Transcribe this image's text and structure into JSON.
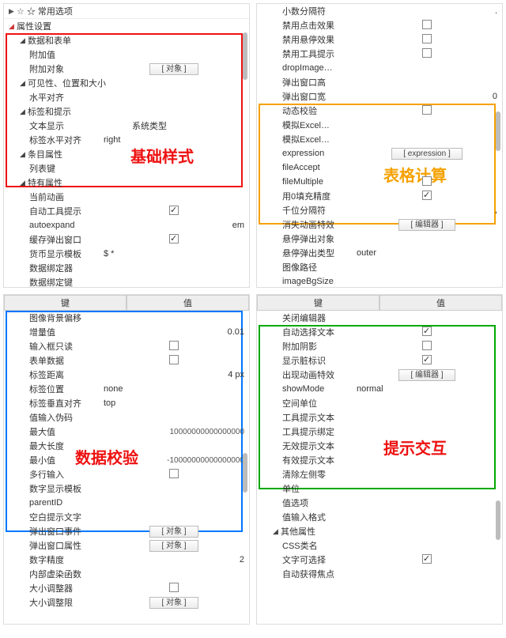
{
  "topLeft": {
    "headers": [
      "☆ 常用选项",
      "属性设置"
    ],
    "groups": [
      {
        "label": "数据和表单",
        "items": [
          {
            "label": "附加值"
          },
          {
            "label": "附加对象",
            "button": "[ 对象 ]"
          }
        ]
      },
      {
        "label": "可见性、位置和大小",
        "items": [
          {
            "label": "水平对齐"
          }
        ]
      },
      {
        "label": "标签和提示",
        "items": [
          {
            "label": "文本显示",
            "value": "系统类型"
          },
          {
            "label": "标签水平对齐",
            "value": "right"
          }
        ]
      },
      {
        "label": "条目属性",
        "items": [
          {
            "label": "列表键"
          }
        ]
      },
      {
        "label": "特有属性",
        "items": [
          {
            "label": "当前动画"
          },
          {
            "label": "自动工具提示",
            "checkbox": true
          },
          {
            "label": "autoexpand",
            "value": "em"
          },
          {
            "label": "缓存弹出窗口",
            "checkbox": true
          },
          {
            "label": "货币显示模板",
            "value_left": "$ *"
          },
          {
            "label": "数据绑定器"
          },
          {
            "label": "数据绑定键"
          }
        ]
      }
    ],
    "annotation": "基础样式"
  },
  "topRight": {
    "items_pre": [
      {
        "label": "小数分隔符",
        "value": "."
      },
      {
        "label": "禁用点击效果",
        "checkbox": false
      },
      {
        "label": "禁用悬停效果",
        "checkbox": false
      },
      {
        "label": "禁用工具提示",
        "checkbox": false
      },
      {
        "label": "dropImage…"
      },
      {
        "label": "弹出窗口高"
      },
      {
        "label": "弹出窗口宽",
        "value": "0"
      }
    ],
    "items_box": [
      {
        "label": "动态校验",
        "checkbox": false
      },
      {
        "label": "模拟Excel…"
      },
      {
        "label": "模拟Excel…"
      },
      {
        "label": "expression",
        "button": "[ expression ]"
      },
      {
        "label": "fileAccept"
      },
      {
        "label": "fileMultiple",
        "checkbox": false
      },
      {
        "label": "用0填充精度",
        "checkbox": true
      },
      {
        "label": "千位分隔符",
        "value": ","
      }
    ],
    "items_post": [
      {
        "label": "消失动画特效",
        "button": "[ 编辑器 ]"
      },
      {
        "label": "悬停弹出对象"
      },
      {
        "label": "悬停弹出类型",
        "value_left": "outer"
      },
      {
        "label": "图像路径"
      },
      {
        "label": "imageBgSize"
      }
    ],
    "annotation": "表格计算"
  },
  "bottomLeft": {
    "kv": [
      "键",
      "值"
    ],
    "items_box": [
      {
        "label": "图像背景偏移"
      },
      {
        "label": "增量值",
        "value": "0.01"
      },
      {
        "label": "输入框只读",
        "checkbox": false
      },
      {
        "label": "表单数据",
        "checkbox": false
      },
      {
        "label": "标签距离",
        "value": "4 px"
      },
      {
        "label": "标签位置",
        "value_left": "none"
      },
      {
        "label": "标签垂直对齐",
        "value_left": "top"
      },
      {
        "label": "值输入伪码"
      },
      {
        "label": "最大值",
        "value": "10000000000000000"
      },
      {
        "label": "最大长度"
      },
      {
        "label": "最小值",
        "value": "-10000000000000000"
      },
      {
        "label": "多行输入",
        "checkbox": false
      },
      {
        "label": "数字显示模板"
      },
      {
        "label": "parentID"
      },
      {
        "label": "空白提示文字"
      }
    ],
    "items_post": [
      {
        "label": "弹出窗口事件",
        "button": "[ 对象 ]"
      },
      {
        "label": "弹出窗口属性",
        "button": "[ 对象 ]"
      },
      {
        "label": "数字精度",
        "value": "2"
      },
      {
        "label": "内部虚染函数"
      },
      {
        "label": "大小调整器",
        "checkbox": false
      },
      {
        "label": "大小调整限",
        "button": "[ 对象 ]"
      }
    ],
    "annotation": "数据校验"
  },
  "bottomRight": {
    "kv": [
      "键",
      "值"
    ],
    "items_pre": [
      {
        "label": "关闭编辑器"
      }
    ],
    "items_box": [
      {
        "label": "自动选择文本",
        "checkbox": true
      },
      {
        "label": "附加阴影",
        "checkbox": false
      },
      {
        "label": "显示脏标识",
        "checkbox": true
      },
      {
        "label": "出现动画特效",
        "button": "[ 编辑器 ]"
      },
      {
        "label": "showMode",
        "value_left": "normal"
      },
      {
        "label": "空间单位"
      },
      {
        "label": "工具提示文本"
      },
      {
        "label": "工具提示绑定"
      },
      {
        "label": "无效提示文本"
      },
      {
        "label": "有效提示文本"
      },
      {
        "label": "清除左侧零"
      }
    ],
    "items_post": [
      {
        "label": "单位"
      },
      {
        "label": "值选项"
      },
      {
        "label": "值输入格式"
      }
    ],
    "group_post": {
      "label": "其他属性",
      "items": [
        {
          "label": "CSS类名"
        },
        {
          "label": "文字可选择",
          "checkbox": true
        },
        {
          "label": "自动获得焦点"
        }
      ]
    },
    "annotation": "提示交互"
  }
}
